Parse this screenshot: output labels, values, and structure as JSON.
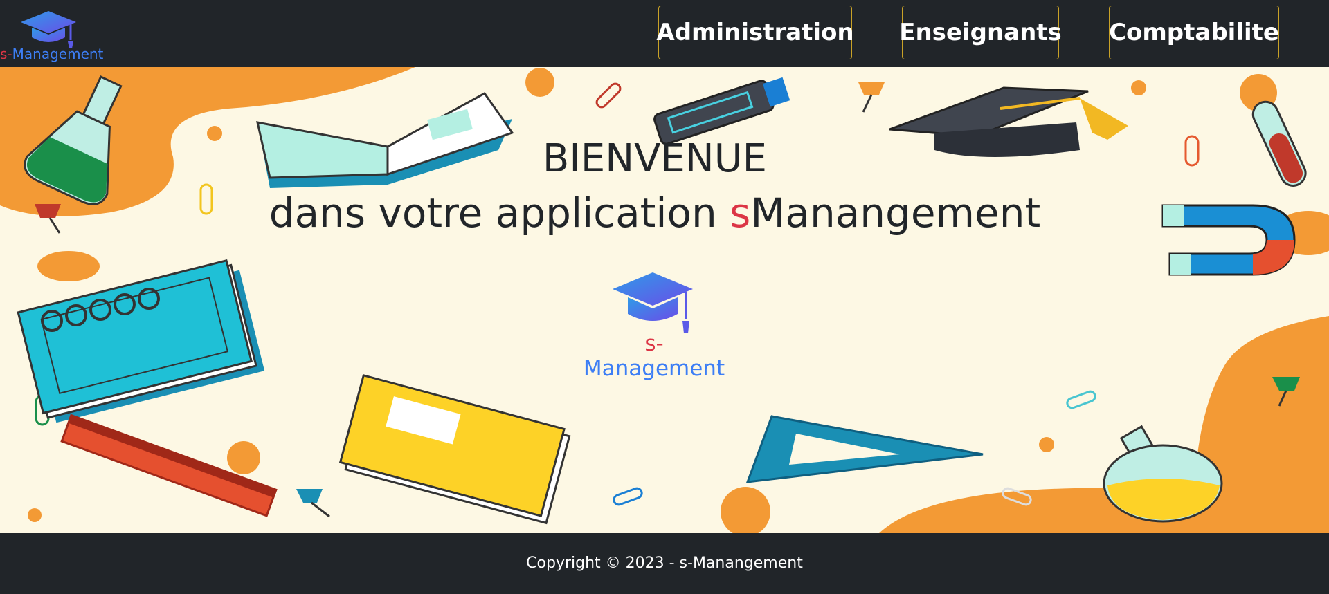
{
  "brand": {
    "prefix": "s-",
    "name": "Management"
  },
  "nav": {
    "administration": "Administration",
    "enseignants": "Enseignants",
    "comptabilite": "Comptabilite"
  },
  "hero": {
    "title": "BIENVENUE",
    "subtitle_before": "dans votre application ",
    "subtitle_highlight": "s",
    "subtitle_after": "Manangement"
  },
  "center_logo": {
    "prefix": "s-",
    "name": "Management"
  },
  "footer": {
    "copyright": "Copyright © 2023 - s-Manangement"
  },
  "colors": {
    "accent_red": "#dc3545",
    "logo_blue": "#3d7ef5",
    "nav_border": "#c9a227",
    "dark": "#212529",
    "cream": "#fdf8e4",
    "orange": "#f39a35"
  },
  "icons": [
    "graduation-cap-icon"
  ]
}
